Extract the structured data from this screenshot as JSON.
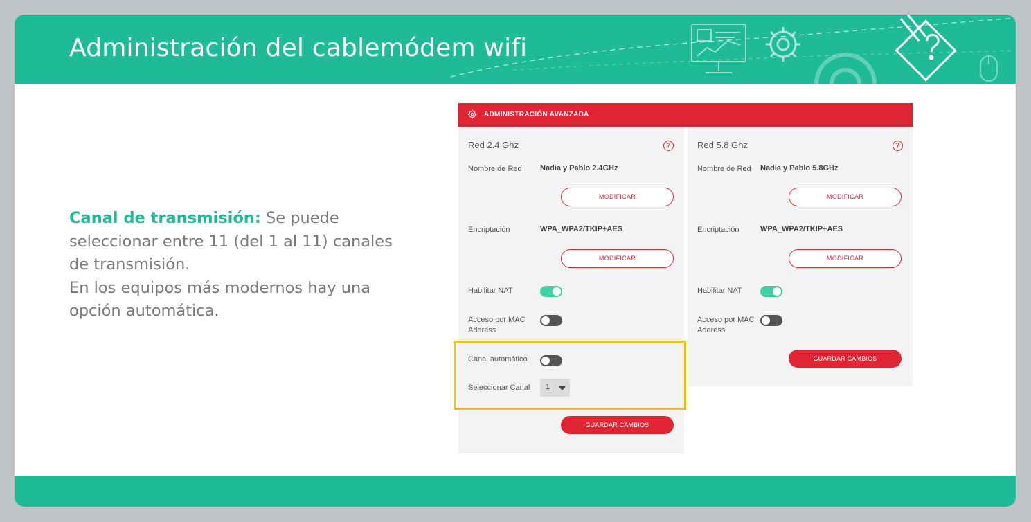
{
  "header": {
    "title": "Administración del cablemódem wifi"
  },
  "description": {
    "keyword": "Canal de transmisión:",
    "line1_rest": " Se puede",
    "line2": "seleccionar entre 11 (del 1 al  11) canales",
    "line3": "de transmisión.",
    "line4": "En los equipos más modernos hay una",
    "line5": "opción automática."
  },
  "router": {
    "title": "ADMINISTRACIÓN AVANZADA",
    "left": {
      "title": "Red 2.4 Ghz",
      "help": "?",
      "network_name_label": "Nombre de Red",
      "network_name_value": "Nadia y Pablo 2.4GHz",
      "modify_label": "MODIFICAR",
      "encryption_label": "Encriptación",
      "encryption_value": "WPA_WPA2/TKIP+AES",
      "modify2_label": "MODIFICAR",
      "nat_label": "Habilitar NAT",
      "nat_enabled": true,
      "mac_label_line1": "Acceso por MAC",
      "mac_label_line2": "Address",
      "mac_enabled": false,
      "auto_channel_label": "Canal automático",
      "auto_channel_enabled": false,
      "select_channel_label": "Seleccionar Canal",
      "channel_value": "1",
      "save_label": "GUARDAR CAMBIOS"
    },
    "right": {
      "title": "Red 5.8 Ghz",
      "help": "?",
      "network_name_label": "Nombre de Red",
      "network_name_value": "Nadia y Pablo 5.8GHz",
      "modify_label": "MODIFICAR",
      "encryption_label": "Encriptación",
      "encryption_value": "WPA_WPA2/TKIP+AES",
      "modify2_label": "MODIFICAR",
      "nat_label": "Habilitar NAT",
      "nat_enabled": true,
      "mac_label_line1": "Acceso por MAC",
      "mac_label_line2": "Address",
      "mac_enabled": false,
      "save_label": "GUARDAR CAMBIOS"
    }
  },
  "colors": {
    "teal": "#1fbb98",
    "router_red": "#e02433",
    "highlight": "#f2c214",
    "toggle_on": "#3ed4a5",
    "toggle_off": "#555555",
    "panel_bg": "#f3f3f3"
  },
  "icons": [
    "monitor-icon",
    "gear-icon",
    "large-gear-icon",
    "mouse-icon",
    "pencil-question-icon",
    "settings-icon",
    "help-icon"
  ]
}
